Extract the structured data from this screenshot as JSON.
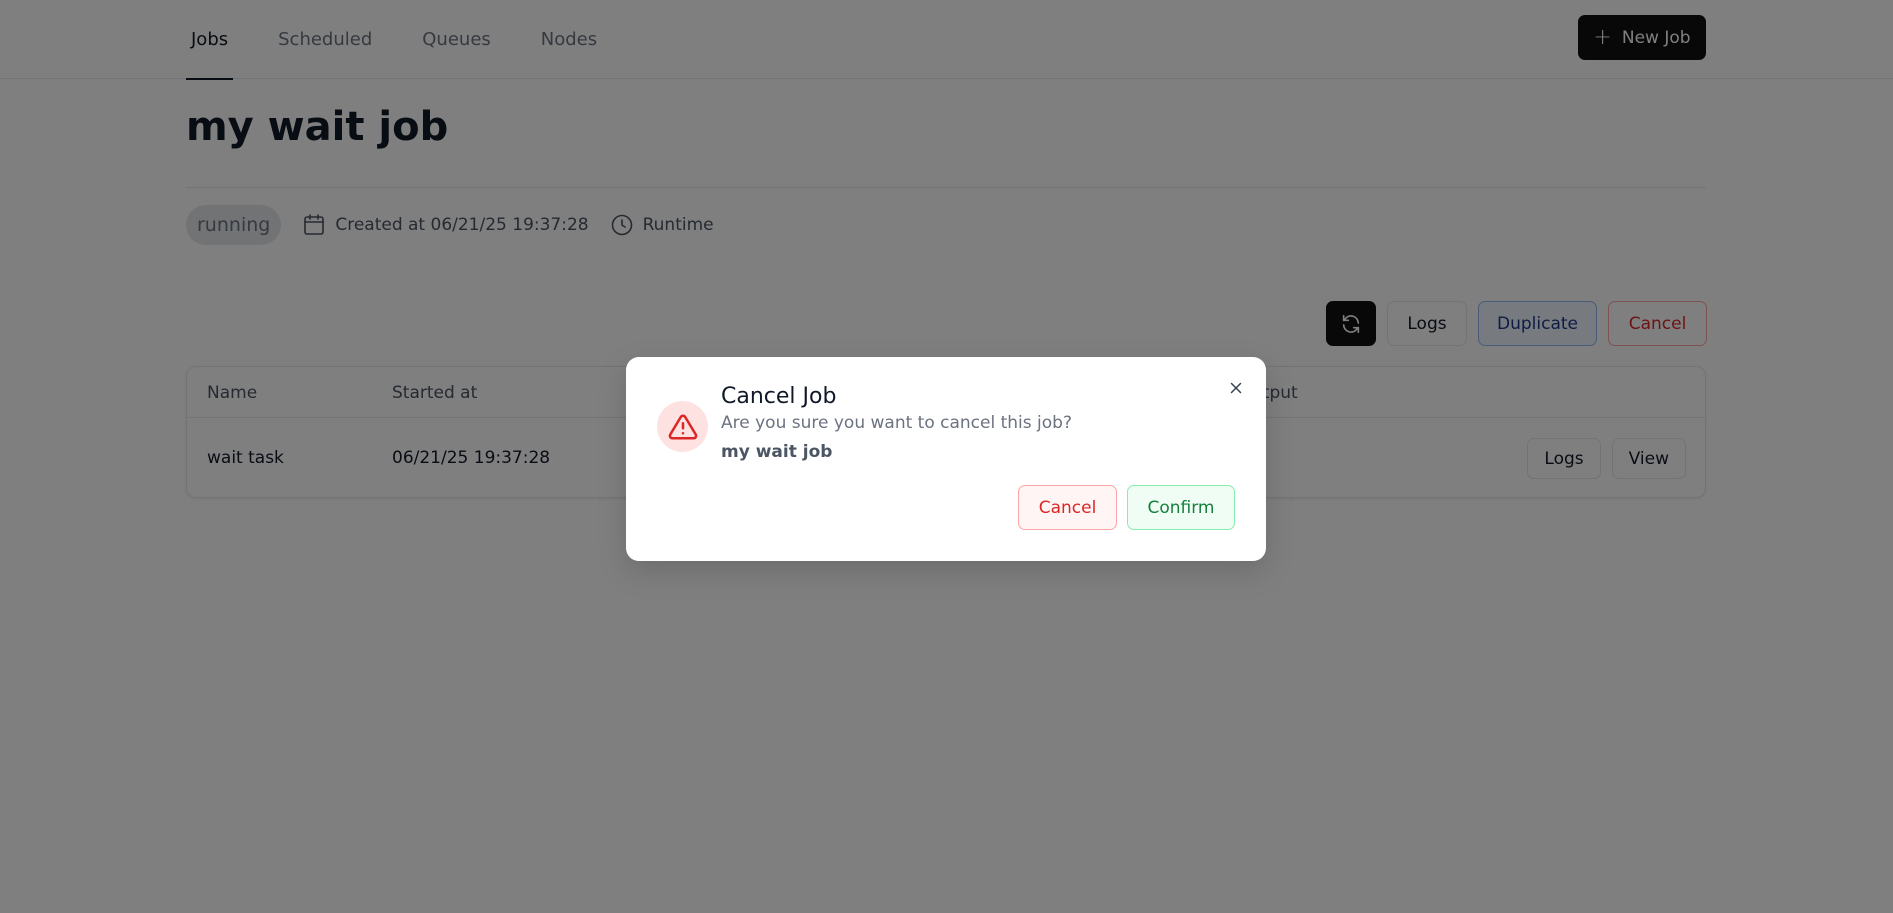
{
  "nav": {
    "tabs": [
      {
        "label": "Jobs",
        "active": true
      },
      {
        "label": "Scheduled",
        "active": false
      },
      {
        "label": "Queues",
        "active": false
      },
      {
        "label": "Nodes",
        "active": false
      }
    ],
    "new_job_label": "New Job",
    "new_job_icon": "plus-icon"
  },
  "job": {
    "title": "my wait job",
    "status": "running",
    "created_at": "Created at 06/21/25 19:37:28",
    "runtime_label": "Runtime"
  },
  "actions": {
    "refresh_icon": "refresh-icon",
    "logs_label": "Logs",
    "duplicate_label": "Duplicate",
    "cancel_label": "Cancel"
  },
  "tasks_table": {
    "columns": [
      "Name",
      "Started at",
      "utput"
    ],
    "rows": [
      {
        "name": "wait task",
        "started_at": "06/21/25 19:37:28",
        "logs_label": "Logs",
        "view_label": "View"
      }
    ]
  },
  "modal": {
    "title": "Cancel Job",
    "description": "Are you sure you want to cancel this job?",
    "job_name": "my wait job",
    "cancel_label": "Cancel",
    "confirm_label": "Confirm",
    "icon": "warning-triangle-icon",
    "close_icon": "close-icon"
  },
  "colors": {
    "primary_dark": "#111111",
    "danger": "#dc2626",
    "success": "#15803d",
    "info": "#1e3a8a"
  }
}
